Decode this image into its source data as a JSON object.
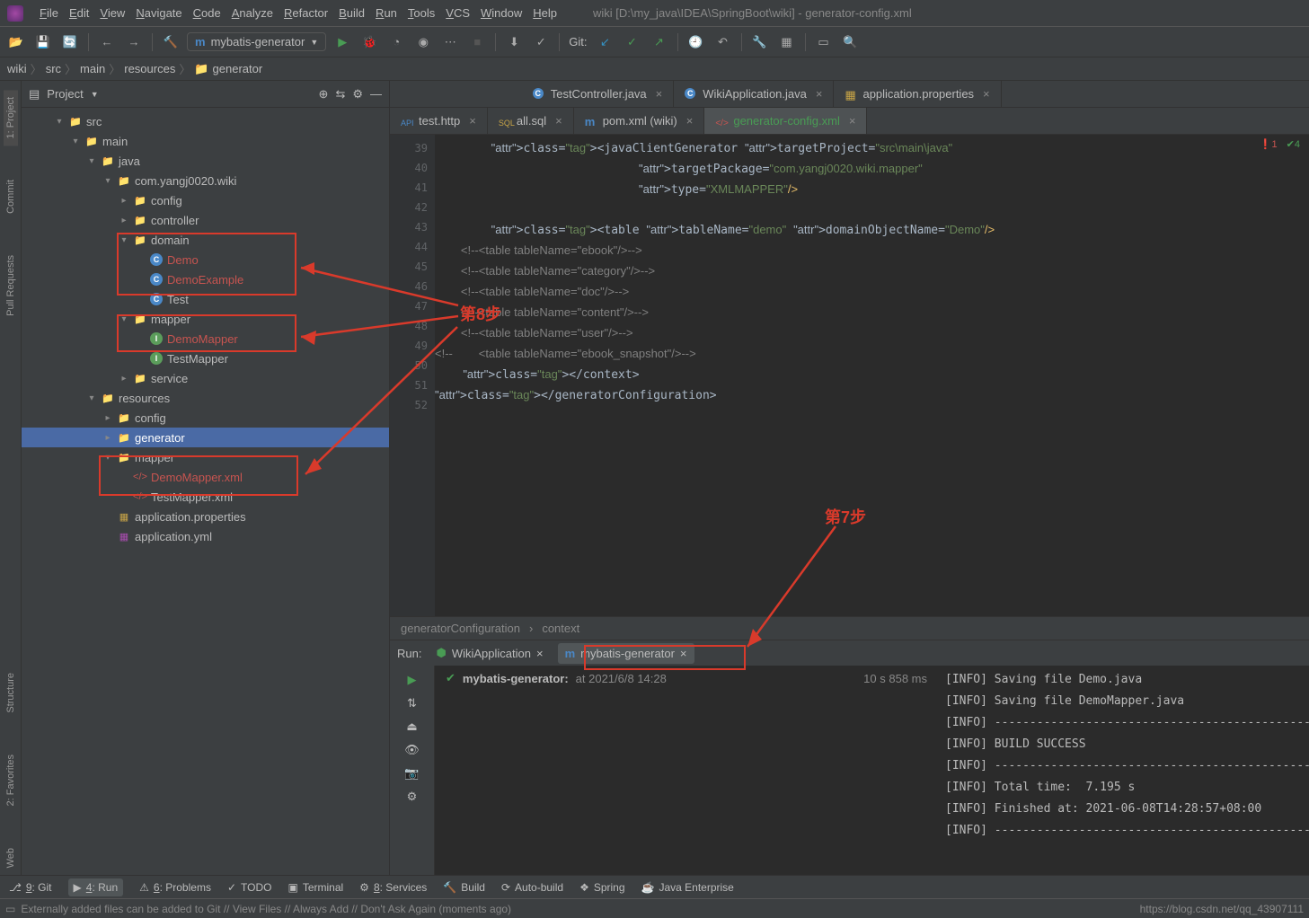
{
  "window": {
    "title": "wiki [D:\\my_java\\IDEA\\SpringBoot\\wiki] - generator-config.xml"
  },
  "menu": [
    "File",
    "Edit",
    "View",
    "Navigate",
    "Code",
    "Analyze",
    "Refactor",
    "Build",
    "Run",
    "Tools",
    "VCS",
    "Window",
    "Help"
  ],
  "runconfig": {
    "label": "mybatis-generator"
  },
  "toolbar": {
    "git_label": "Git:"
  },
  "nav": [
    "wiki",
    "src",
    "main",
    "resources",
    "generator"
  ],
  "project": {
    "title": "Project",
    "tree": [
      {
        "d": 2,
        "a": "▾",
        "t": "folder",
        "l": "src"
      },
      {
        "d": 3,
        "a": "▾",
        "t": "folder",
        "l": "main"
      },
      {
        "d": 4,
        "a": "▾",
        "t": "folder",
        "l": "java"
      },
      {
        "d": 5,
        "a": "▾",
        "t": "pkg",
        "l": "com.yangj0020.wiki"
      },
      {
        "d": 6,
        "a": "▸",
        "t": "pkg",
        "l": "config"
      },
      {
        "d": 6,
        "a": "▸",
        "t": "pkg",
        "l": "controller"
      },
      {
        "d": 6,
        "a": "▾",
        "t": "pkg",
        "l": "domain",
        "box": 1
      },
      {
        "d": 7,
        "a": "",
        "t": "class",
        "l": "Demo",
        "hl": 1,
        "box": 1
      },
      {
        "d": 7,
        "a": "",
        "t": "class",
        "l": "DemoExample",
        "hl": 1,
        "box": 1
      },
      {
        "d": 7,
        "a": "",
        "t": "class",
        "l": "Test"
      },
      {
        "d": 6,
        "a": "▾",
        "t": "pkg",
        "l": "mapper",
        "box": 2
      },
      {
        "d": 7,
        "a": "",
        "t": "iface",
        "l": "DemoMapper",
        "hl": 1,
        "box": 2
      },
      {
        "d": 7,
        "a": "",
        "t": "iface",
        "l": "TestMapper"
      },
      {
        "d": 6,
        "a": "▸",
        "t": "pkg",
        "l": "service"
      },
      {
        "d": 4,
        "a": "▾",
        "t": "folder",
        "l": "resources"
      },
      {
        "d": 5,
        "a": "▸",
        "t": "folder",
        "l": "config"
      },
      {
        "d": 5,
        "a": "▸",
        "t": "folder",
        "l": "generator",
        "sel": 1
      },
      {
        "d": 5,
        "a": "▾",
        "t": "folder",
        "l": "mapper",
        "box": 3
      },
      {
        "d": 6,
        "a": "",
        "t": "xml",
        "l": "DemoMapper.xml",
        "hl": 1,
        "box": 3
      },
      {
        "d": 6,
        "a": "",
        "t": "xml",
        "l": "TestMapper.xml"
      },
      {
        "d": 5,
        "a": "",
        "t": "prop",
        "l": "application.properties"
      },
      {
        "d": 5,
        "a": "",
        "t": "yml",
        "l": "application.yml"
      }
    ]
  },
  "left_tabs": [
    "1: Project",
    "Commit",
    "Pull Requests"
  ],
  "left_tabs2": [
    "Structure",
    "2: Favorites",
    "Web"
  ],
  "tabs1": [
    {
      "l": "TestController.java",
      "ico": "class"
    },
    {
      "l": "WikiApplication.java",
      "ico": "class"
    },
    {
      "l": "application.properties",
      "ico": "prop"
    }
  ],
  "tabs2": [
    {
      "l": "test.http",
      "ico": "http"
    },
    {
      "l": "all.sql",
      "ico": "sql"
    },
    {
      "l": "pom.xml (wiki)",
      "ico": "maven"
    },
    {
      "l": "generator-config.xml",
      "ico": "xml",
      "active": 1
    }
  ],
  "code": {
    "start": 39,
    "end": 52,
    "warn_err": "1",
    "warn_ok": "4",
    "lines": [
      "        <javaClientGenerator targetProject=\"src\\main\\java\"",
      "                             targetPackage=\"com.yangj0020.wiki.mapper\"",
      "                             type=\"XMLMAPPER\"/>",
      "",
      "        <table tableName=\"demo\" domainObjectName=\"Demo\"/>",
      "        <!--<table tableName=\"ebook\"/>-->",
      "        <!--<table tableName=\"category\"/>-->",
      "        <!--<table tableName=\"doc\"/>-->",
      "        <!--<table tableName=\"content\"/>-->",
      "        <!--<table tableName=\"user\"/>-->",
      "<!--        <table tableName=\"ebook_snapshot\"/>-->",
      "    </context>",
      "</generatorConfiguration>",
      ""
    ]
  },
  "crumbs": [
    "generatorConfiguration",
    "context"
  ],
  "run": {
    "title": "Run:",
    "tabs": [
      {
        "l": "WikiApplication"
      },
      {
        "l": "mybatis-generator",
        "active": 1
      }
    ],
    "task": "mybatis-generator:",
    "time": "at 2021/6/8 14:28",
    "dur": "10 s 858 ms",
    "out": [
      "[INFO] Saving file Demo.java",
      "[INFO] Saving file DemoMapper.java",
      "[INFO] ------------------------------------------------------------------------",
      "[INFO] BUILD SUCCESS",
      "[INFO] ------------------------------------------------------------------------",
      "[INFO] Total time:  7.195 s",
      "[INFO] Finished at: 2021-06-08T14:28:57+08:00",
      "[INFO] ------------------------------------------------------------------------"
    ]
  },
  "bottom": [
    {
      "l": "9: Git",
      "u": "9"
    },
    {
      "l": "4: Run",
      "u": "4",
      "sel": 1
    },
    {
      "l": "6: Problems",
      "u": "6"
    },
    {
      "l": "TODO"
    },
    {
      "l": "Terminal"
    },
    {
      "l": "8: Services",
      "u": "8"
    },
    {
      "l": "Build"
    },
    {
      "l": "Auto-build"
    },
    {
      "l": "Spring"
    },
    {
      "l": "Java Enterprise"
    }
  ],
  "status": {
    "msg": "Externally added files can be added to Git // View Files // Always Add // Don't Ask Again (moments ago)",
    "url": "https://blog.csdn.net/qq_43907111"
  },
  "annotations": {
    "step7": "第7步",
    "step8": "第8步"
  }
}
